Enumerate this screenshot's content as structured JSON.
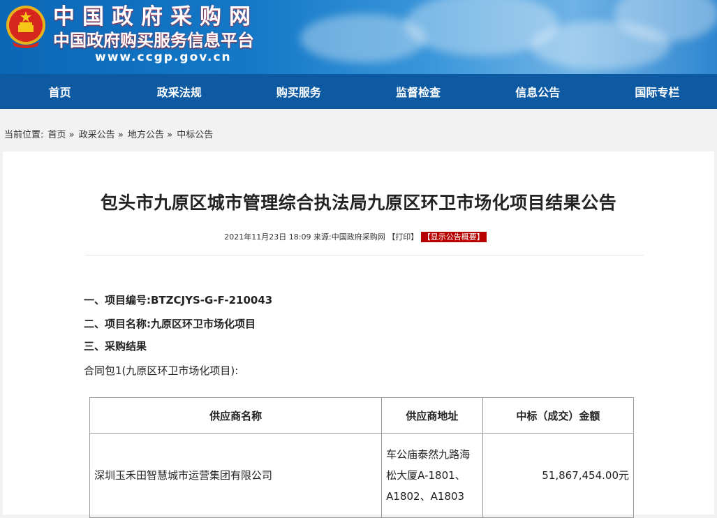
{
  "header": {
    "site_name": "中国政府采购网",
    "platform_name": "中国政府购买服务信息平台",
    "url": "www.ccgp.gov.cn",
    "emblem_icon": "national-emblem-icon",
    "accent_color": "#0d5aa3",
    "emblem_red": "#d7261e"
  },
  "nav": {
    "items": [
      "首页",
      "政采法规",
      "购买服务",
      "监督检查",
      "信息公告",
      "国际专栏"
    ]
  },
  "breadcrumb": {
    "prefix": "当前位置:",
    "items": [
      "首页 »",
      "政采公告 »",
      "地方公告 »",
      "中标公告"
    ]
  },
  "article": {
    "title": "包头市九原区城市管理综合执法局九原区环卫市场化项目结果公告",
    "datetime": "2021年11月23日 18:09",
    "source_label": "来源:",
    "source": "中国政府采购网",
    "print_label": "【打印】",
    "summary_label": "【显示公告概要】",
    "summary_color": "#b60000",
    "sec1_label": "一、项目编号:",
    "sec1_value": "BTZCJYS-G-F-210043",
    "sec2_label": "二、项目名称:",
    "sec2_value": "九原区环卫市场化项目",
    "sec3_label": "三、采购结果",
    "package": "合同包1(九原区环卫市场化项目):"
  },
  "table": {
    "headers": [
      "供应商名称",
      "供应商地址",
      "中标（成交）金额"
    ],
    "rows": [
      {
        "name": "深圳玉禾田智慧城市运营集团有限公司",
        "address": "车公庙泰然九路海松大厦A-1801、A1802、A1803",
        "amount": "51,867,454.00元"
      }
    ]
  }
}
